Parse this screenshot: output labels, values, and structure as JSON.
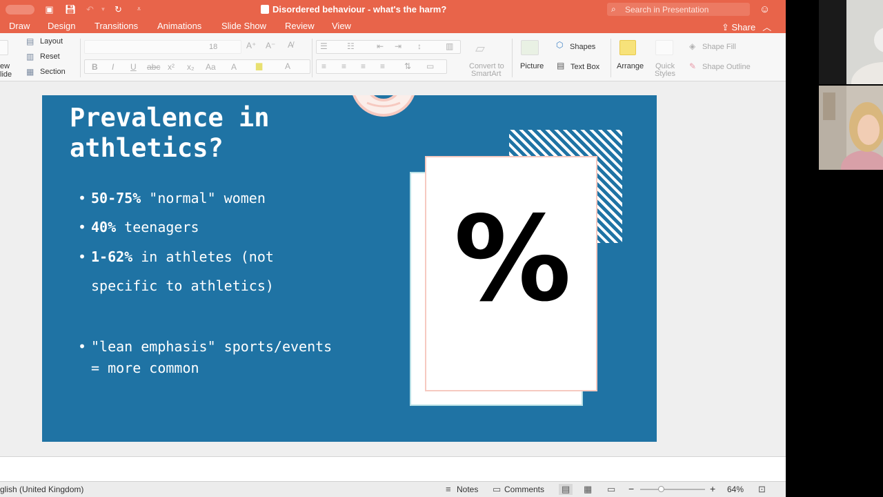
{
  "window": {
    "title": "Disordered behaviour - what's the harm?",
    "search_placeholder": "Search in Presentation",
    "share_label": "Share"
  },
  "ribbon_tabs": [
    "Draw",
    "Design",
    "Transitions",
    "Animations",
    "Slide Show",
    "Review",
    "View"
  ],
  "ribbon": {
    "new_slide_label_line1": "ew",
    "new_slide_label_line2": "lide",
    "layout_label": "Layout",
    "reset_label": "Reset",
    "section_label": "Section",
    "font_size": "18",
    "convert_label_line1": "Convert to",
    "convert_label_line2": "SmartArt",
    "picture_label": "Picture",
    "shapes_label": "Shapes",
    "textbox_label": "Text Box",
    "arrange_label": "Arrange",
    "quick_styles_line1": "Quick",
    "quick_styles_line2": "Styles",
    "shape_fill_label": "Shape Fill",
    "shape_outline_label": "Shape Outline"
  },
  "slide": {
    "title": "Prevalence in\nathletics?",
    "bullets": [
      {
        "bold": "50-75%",
        "rest": " \"normal\" women"
      },
      {
        "bold": "40%",
        "rest": " teenagers"
      },
      {
        "bold": "1-62%",
        "rest": " in athletes (not"
      }
    ],
    "bullet3_cont": "specific to athletics)",
    "bullet4_line1": "\"lean emphasis\" sports/events",
    "bullet4_line2": "= more common",
    "percent_symbol": "%",
    "colors": {
      "background": "#1f73a4",
      "accent_pink": "#f6c9c0",
      "accent_teal": "#b8e0e6"
    }
  },
  "statusbar": {
    "language": "glish (United Kingdom)",
    "notes_label": "Notes",
    "comments_label": "Comments",
    "zoom_minus": "−",
    "zoom_plus": "+",
    "zoom_level": "64%",
    "zoom_fraction": 0.32
  },
  "colors": {
    "titlebar": "#e8644a"
  }
}
